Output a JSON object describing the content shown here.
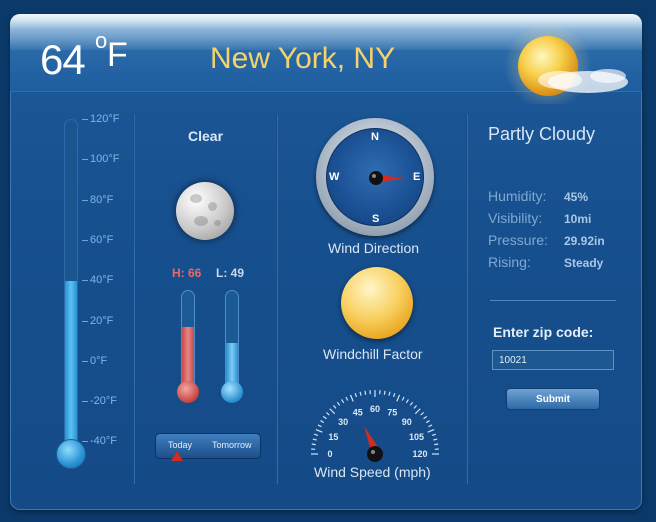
{
  "header": {
    "temperature": "64",
    "degree_symbol": "o",
    "unit": "F",
    "city": "New York, NY"
  },
  "thermometer": {
    "fill_fraction": 0.51,
    "scale": [
      {
        "label": "120°F"
      },
      {
        "label": "100°F"
      },
      {
        "label": "80°F"
      },
      {
        "label": "60°F"
      },
      {
        "label": "40°F"
      },
      {
        "label": "20°F"
      },
      {
        "label": "0°F"
      },
      {
        "label": "-20°F"
      },
      {
        "label": "-40°F"
      }
    ]
  },
  "sky": {
    "condition": "Clear"
  },
  "high_low": {
    "high": "H: 66",
    "low": "L: 49",
    "high_fill_fraction": 0.62,
    "low_fill_fraction": 0.45
  },
  "day_toggle": {
    "today": "Today",
    "tomorrow": "Tomorrow",
    "selected": "Today"
  },
  "wind": {
    "direction_label": "Wind Direction",
    "compass": {
      "n": "N",
      "e": "E",
      "s": "S",
      "w": "W"
    },
    "windchill_label": "Windchill Factor",
    "speed_label": "Wind Speed (mph)",
    "speed_scale": [
      "0",
      "15",
      "30",
      "45",
      "60",
      "75",
      "90",
      "105",
      "120"
    ]
  },
  "conditions": {
    "summary": "Partly Cloudy",
    "stats": [
      {
        "name": "Humidity:",
        "value": "45%"
      },
      {
        "name": "Visibility:",
        "value": "10mi"
      },
      {
        "name": "Pressure:",
        "value": "29.92in"
      },
      {
        "name": "Rising:",
        "value": "Steady"
      }
    ]
  },
  "zip": {
    "label": "Enter zip code:",
    "value": "10021",
    "submit": "Submit"
  },
  "colors": {
    "background": "#0b3a6a",
    "panel": "#17508f",
    "city": "#f5d36a",
    "high": "#e96a63",
    "mercury": "#5bc2f2"
  }
}
